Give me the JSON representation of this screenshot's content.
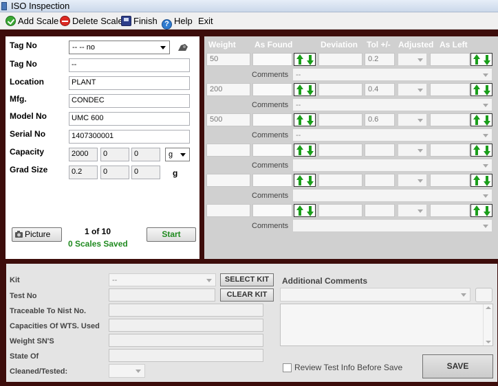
{
  "window": {
    "title": "ISO Inspection"
  },
  "menu": {
    "add_scale": "Add Scale",
    "delete_scale": "Delete Scale",
    "finish": "Finish",
    "help": "Help",
    "exit": "Exit",
    "icons": {
      "add": "check-circle-icon",
      "delete": "no-entry-icon",
      "finish": "save-disk-icon",
      "help": "help-icon"
    }
  },
  "scale": {
    "tag_no_label": "Tag No",
    "tag_no_select": "-- -- no",
    "tag_no_label2": "Tag No",
    "tag_no_value": "--",
    "location_label": "Location",
    "location_value": "PLANT",
    "mfg_label": "Mfg.",
    "mfg_value": "CONDEC",
    "model_label": "Model No",
    "model_value": "UMC 600",
    "serial_label": "Serial No",
    "serial_value": "1407300001",
    "capacity_label": "Capacity",
    "capacity_values": [
      "2000",
      "0",
      "0"
    ],
    "capacity_unit": "g",
    "grad_label": "Grad Size",
    "grad_values": [
      "0.2",
      "0",
      "0"
    ],
    "grad_unit": "g",
    "picture_button": "Picture",
    "counter": "1 of 10",
    "saved": "0 Scales Saved",
    "start_button": "Start"
  },
  "weights": {
    "headers": {
      "weight": "Weight",
      "as_found": "As Found",
      "deviation": "Deviation",
      "tol": "Tol +/-",
      "adjusted": "Adjusted",
      "as_left": "As Left"
    },
    "comments_label": "Comments",
    "comments_value": "--",
    "rows": [
      {
        "weight": "50",
        "tol": "0.2"
      },
      {
        "weight": "200",
        "tol": "0.4"
      },
      {
        "weight": "500",
        "tol": "0.6"
      },
      {
        "weight": "",
        "tol": ""
      },
      {
        "weight": "",
        "tol": ""
      },
      {
        "weight": "",
        "tol": ""
      }
    ]
  },
  "kit": {
    "kit_label": "Kit",
    "kit_value": "--",
    "select_kit": "SELECT KIT",
    "test_no_label": "Test No",
    "clear_kit": "CLEAR KIT",
    "traceable_label": "Traceable To Nist No.",
    "capacities_label": "Capacities Of WTS. Used",
    "weight_sn_label": "Weight SN'S",
    "state_of_label": "State Of",
    "cleaned_label": "Cleaned/Tested:",
    "additional_comments": "Additional Comments",
    "review_label": "Review Test Info Before Save",
    "save_button": "SAVE"
  },
  "colors": {
    "background": "#3d0d0b",
    "grid_panel": "#d0d0d0",
    "green_text": "#1f8a1f",
    "arrow_green": "#1a9e1a"
  }
}
